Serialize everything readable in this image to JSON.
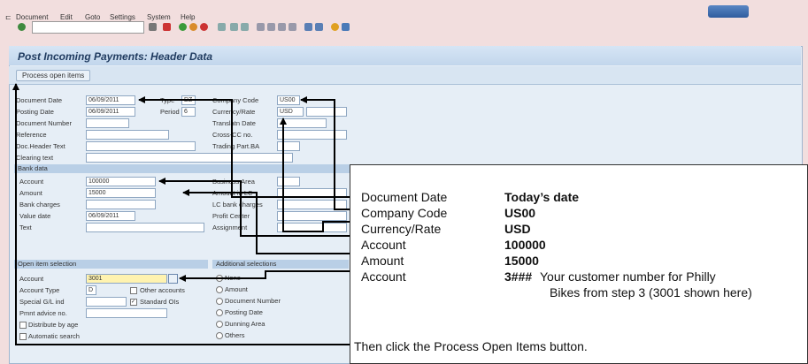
{
  "menu": [
    "Document",
    "Edit",
    "Goto",
    "Settings",
    "System",
    "Help"
  ],
  "page_title": "Post Incoming Payments: Header Data",
  "process_button": "Process open items",
  "header_fields": {
    "doc_date_label": "Document Date",
    "doc_date_value": "06/09/2011",
    "type_label": "Type",
    "type_value": "DZ",
    "company_code_label": "Company Code",
    "company_code_value": "US00",
    "posting_date_label": "Posting Date",
    "posting_date_value": "06/09/2011",
    "period_label": "Period",
    "period_value": "6",
    "currency_label": "Currency/Rate",
    "currency_value": "USD",
    "doc_number_label": "Document Number",
    "translation_label": "Translatn Date",
    "reference_label": "Reference",
    "cross_cc_label": "Cross-CC no.",
    "doc_header_label": "Doc.Header Text",
    "trading_label": "Trading Part.BA",
    "clearing_label": "Clearing text"
  },
  "bank_data": {
    "section_label": "Bank data",
    "account_label": "Account",
    "account_value": "100000",
    "business_area_label": "Business Area",
    "amount_label": "Amount",
    "amount_value": "15000",
    "amount_lc_label": "Amount in LC",
    "bank_charges_label": "Bank charges",
    "lc_bank_charges_label": "LC bank charges",
    "value_date_label": "Value date",
    "value_date_value": "06/09/2011",
    "profit_center_label": "Profit Center",
    "text_label": "Text",
    "assignment_label": "Assignment"
  },
  "open_items": {
    "section_label": "Open item selection",
    "account_label": "Account",
    "account_value": "3001",
    "account_type_label": "Account Type",
    "account_type_value": "D",
    "other_accounts_label": "Other accounts",
    "special_gl_label": "Special G/L ind",
    "standard_ois_label": "Standard OIs",
    "pmnt_advice_label": "Pmnt advice no.",
    "distribute_label": "Distribute by age",
    "automatic_label": "Automatic search"
  },
  "additional": {
    "section_label": "Additional selections",
    "options": [
      "None",
      "Amount",
      "Document Number",
      "Posting Date",
      "Dunning Area",
      "Others"
    ]
  },
  "callout": {
    "rows": [
      {
        "label": "Document Date",
        "value": "Today’s date"
      },
      {
        "label": "Company Code",
        "value": "US00"
      },
      {
        "label": "Currency/Rate",
        "value": "USD"
      },
      {
        "label": "Account",
        "value": "100000"
      },
      {
        "label": "Amount",
        "value": "15000"
      },
      {
        "label": "Account",
        "value": "3###"
      }
    ],
    "note_line1": "Your customer number for Philly",
    "note_line2": "Bikes from step 3 (3001 shown here)",
    "footer": "Then click the Process Open Items button."
  }
}
